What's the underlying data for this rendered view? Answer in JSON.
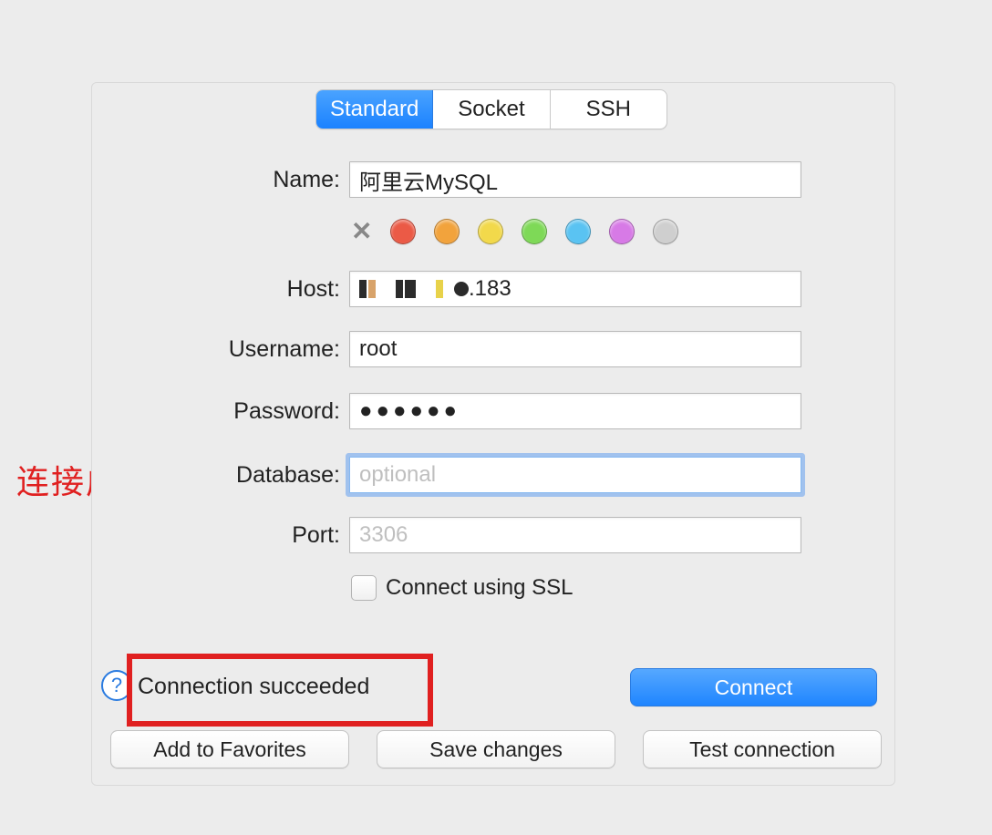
{
  "tabs": {
    "standard": "Standard",
    "socket": "Socket",
    "ssh": "SSH"
  },
  "labels": {
    "name": "Name:",
    "host": "Host:",
    "username": "Username:",
    "password": "Password:",
    "database": "Database:",
    "port": "Port:"
  },
  "values": {
    "name": "阿里云MySQL",
    "host_suffix": ".183",
    "username": "root",
    "password_mask": "●●●●●●",
    "database": "",
    "port": "3306"
  },
  "placeholders": {
    "database": "optional"
  },
  "checkbox": {
    "ssl_label": "Connect using SSL"
  },
  "colors": {
    "red": "#eb5a46",
    "orange": "#f2a33c",
    "yellow": "#f2d94b",
    "green": "#7ed957",
    "blue": "#5ac3f2",
    "purple": "#d77ae6",
    "gray": "#cfcfcf"
  },
  "status": {
    "text": "Connection succeeded"
  },
  "buttons": {
    "connect": "Connect",
    "add_fav": "Add to Favorites",
    "save": "Save changes",
    "test": "Test connection"
  },
  "annotation": {
    "text": "连接成功"
  },
  "help": {
    "glyph": "?"
  }
}
